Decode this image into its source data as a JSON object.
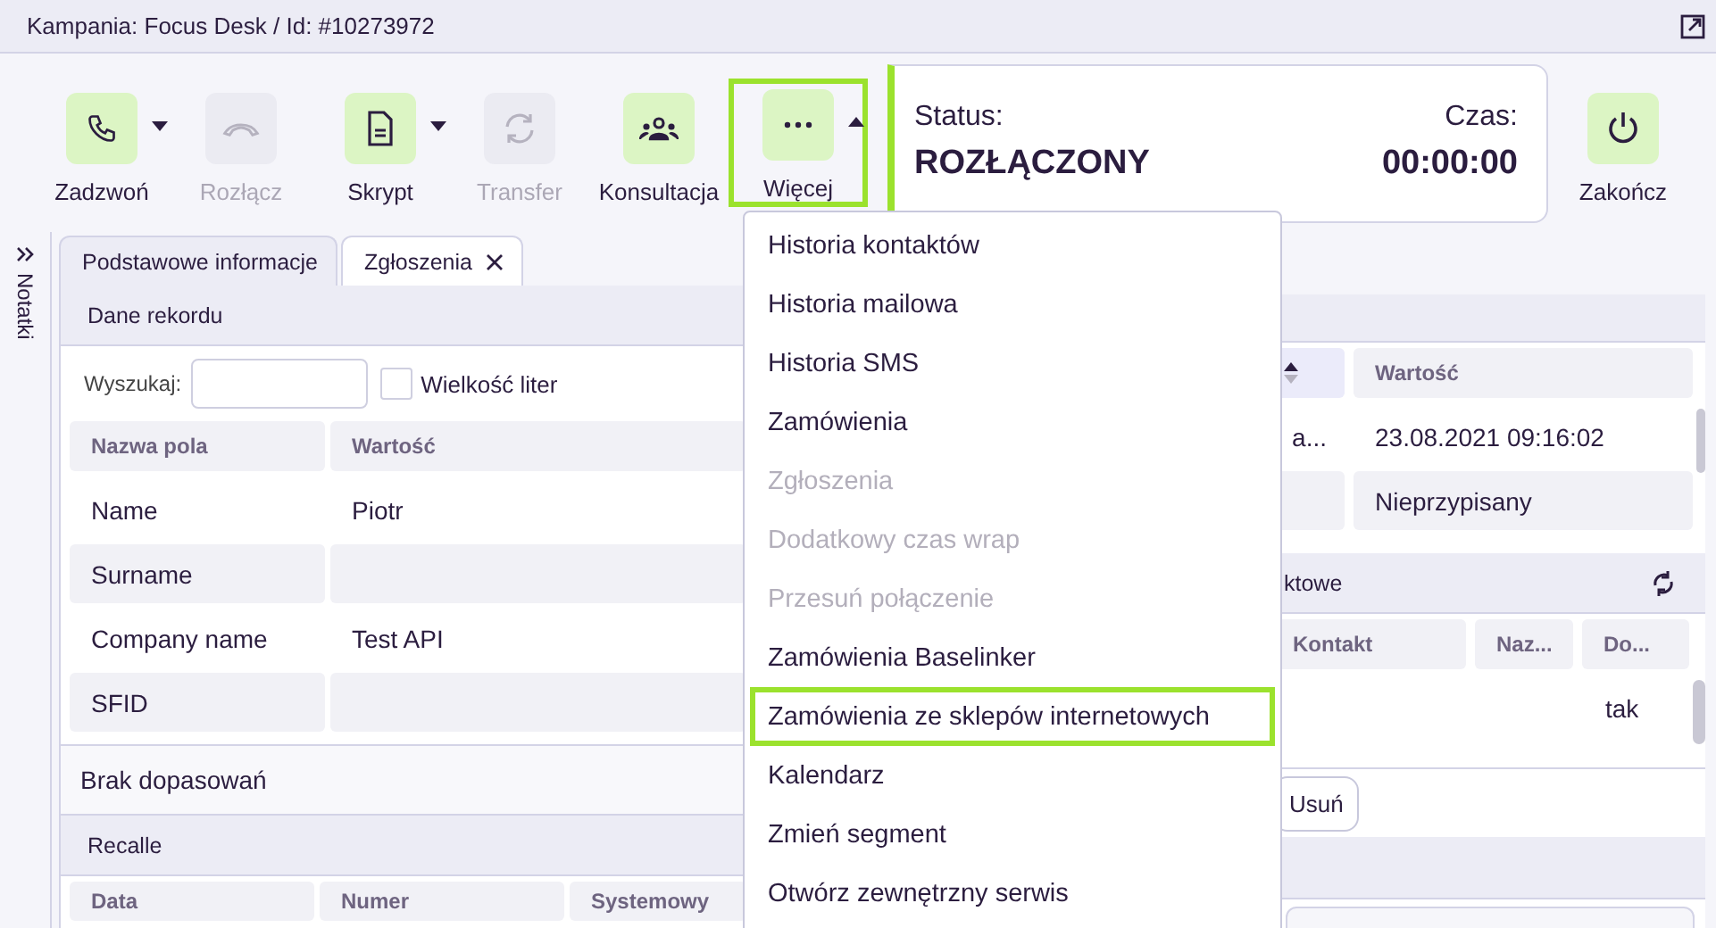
{
  "header": {
    "title": "Kampania: Focus Desk / Id: #10273972"
  },
  "toolbar": [
    {
      "label": "Zadzwoń",
      "disabled": false,
      "dropdown": true,
      "open": false,
      "highlighted": false
    },
    {
      "label": "Rozłącz",
      "disabled": true,
      "highlighted": false
    },
    {
      "label": "Skrypt",
      "disabled": false,
      "dropdown": true,
      "open": false,
      "highlighted": false
    },
    {
      "label": "Transfer",
      "disabled": true,
      "highlighted": false
    },
    {
      "label": "Konsultacja",
      "disabled": false,
      "highlighted": false
    },
    {
      "label": "Więcej",
      "disabled": false,
      "dropdown": true,
      "open": true,
      "highlighted": true
    }
  ],
  "status": {
    "label": "Status:",
    "value": "ROZŁĄCZONY",
    "time_label": "Czas:",
    "time": "00:00:00"
  },
  "end_button": {
    "label": "Zakończ"
  },
  "sidebar": {
    "label": "Notatki"
  },
  "tabs": [
    {
      "label": "Podstawowe informacje",
      "selected": false,
      "closable": false
    },
    {
      "label": "Zgłoszenia",
      "selected": true,
      "closable": true
    }
  ],
  "record": {
    "title": "Dane rekordu",
    "search_label": "Wyszukaj:",
    "case_label": "Wielkość liter",
    "case_checked": false,
    "columns": [
      "Nazwa pola",
      "Wartość"
    ],
    "rows": [
      {
        "name": "Name",
        "value": "Piotr"
      },
      {
        "name": "Surname",
        "value": ""
      },
      {
        "name": "Company name",
        "value": "Test API"
      },
      {
        "name": "SFID",
        "value": ""
      }
    ]
  },
  "no_match": {
    "text": "Brak dopasowań"
  },
  "recalle": {
    "title": "Recalle",
    "columns": [
      "Data",
      "Numer",
      "Systemowy"
    ]
  },
  "right_table": {
    "columns": [
      "",
      "Wartość"
    ],
    "rows": [
      [
        "a...",
        "23.08.2021 09:16:02"
      ],
      [
        "",
        "Nieprzypisany"
      ]
    ]
  },
  "contacts": {
    "title": "ktowe",
    "columns": [
      "Kontakt",
      "Naz...",
      "Do..."
    ],
    "rows": [
      [
        "",
        "",
        "tak"
      ]
    ]
  },
  "delete_button": {
    "label": "Usuń"
  },
  "menu": [
    {
      "label": "Historia kontaktów",
      "disabled": false,
      "highlighted": false
    },
    {
      "label": "Historia mailowa",
      "disabled": false,
      "highlighted": false
    },
    {
      "label": "Historia SMS",
      "disabled": false,
      "highlighted": false
    },
    {
      "label": "Zamówienia",
      "disabled": false,
      "highlighted": false
    },
    {
      "label": "Zgłoszenia",
      "disabled": true,
      "highlighted": false
    },
    {
      "label": "Dodatkowy czas wrap",
      "disabled": true,
      "highlighted": false
    },
    {
      "label": "Przesuń połączenie",
      "disabled": true,
      "highlighted": false
    },
    {
      "label": "Zamówienia Baselinker",
      "disabled": false,
      "highlighted": false
    },
    {
      "label": "Zamówienia ze sklepów internetowych",
      "disabled": false,
      "highlighted": true
    },
    {
      "label": "Kalendarz",
      "disabled": false,
      "highlighted": false
    },
    {
      "label": "Zmień segment",
      "disabled": false,
      "highlighted": false
    },
    {
      "label": "Otwórz zewnętrzny serwis",
      "disabled": false,
      "highlighted": false
    }
  ]
}
